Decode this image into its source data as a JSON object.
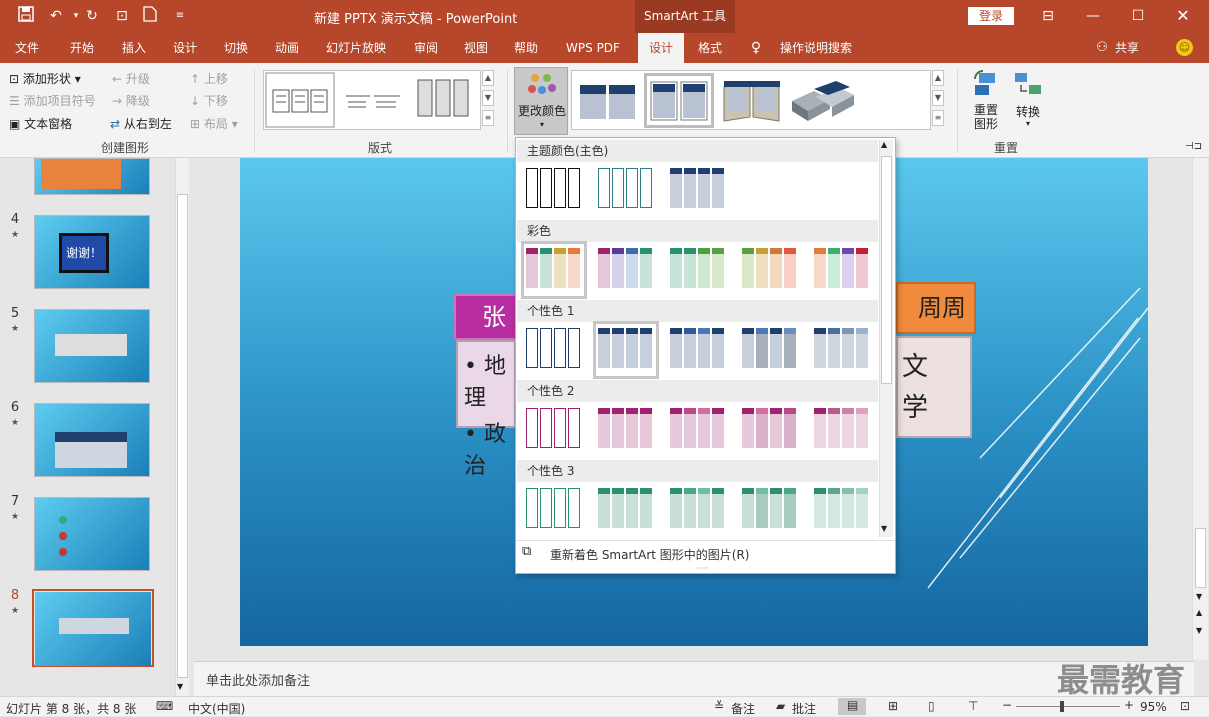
{
  "title_bar": {
    "doc_title": "新建 PPTX 演示文稿 - PowerPoint",
    "context_tool": "SmartArt 工具",
    "login": "登录"
  },
  "tabs": [
    "文件",
    "开始",
    "插入",
    "设计",
    "切换",
    "动画",
    "幻灯片放映",
    "审阅",
    "视图",
    "帮助",
    "WPS PDF",
    "设计",
    "格式"
  ],
  "tell_me": "操作说明搜索",
  "share": "共享",
  "ribbon": {
    "create": {
      "add_shape": "添加形状",
      "add_bullet": "添加项目符号",
      "text_pane": "文本窗格",
      "promote": "升级",
      "demote": "降级",
      "rtl": "从右到左",
      "up": "上移",
      "down": "下移",
      "layout": "布局",
      "label": "创建图形"
    },
    "layouts": {
      "label": "版式"
    },
    "change_colors": "更改颜色",
    "reset": {
      "reset_graphic": "重置\n图形",
      "convert": "转换",
      "label": "重置"
    }
  },
  "slides": [
    {
      "num": "4",
      "text": "谢谢！"
    },
    {
      "num": "5"
    },
    {
      "num": "6"
    },
    {
      "num": "7"
    },
    {
      "num": "8"
    }
  ],
  "slide_content": {
    "box1": "张三",
    "box2": "周周",
    "bullet1": "• 地理",
    "bullet2": "• 政治",
    "right1": "文",
    "right2": "学"
  },
  "dropdown": {
    "sections": [
      "主题颜色(主色)",
      "彩色",
      "个性色 1",
      "个性色 2",
      "个性色 3"
    ],
    "recolor": "重新着色 SmartArt 图形中的图片(R)"
  },
  "notes_placeholder": "单击此处添加备注",
  "status": {
    "slide_info": "幻灯片 第 8 张，共 8 张",
    "language": "中文(中国)",
    "notes": "备注",
    "comments": "批注",
    "zoom": "95%"
  },
  "watermark": "最需教育",
  "colors": {
    "accent": "#b7472a",
    "accent1": "#1f3f6e",
    "accent2": "#a0226e",
    "accent3": "#2a9070"
  }
}
